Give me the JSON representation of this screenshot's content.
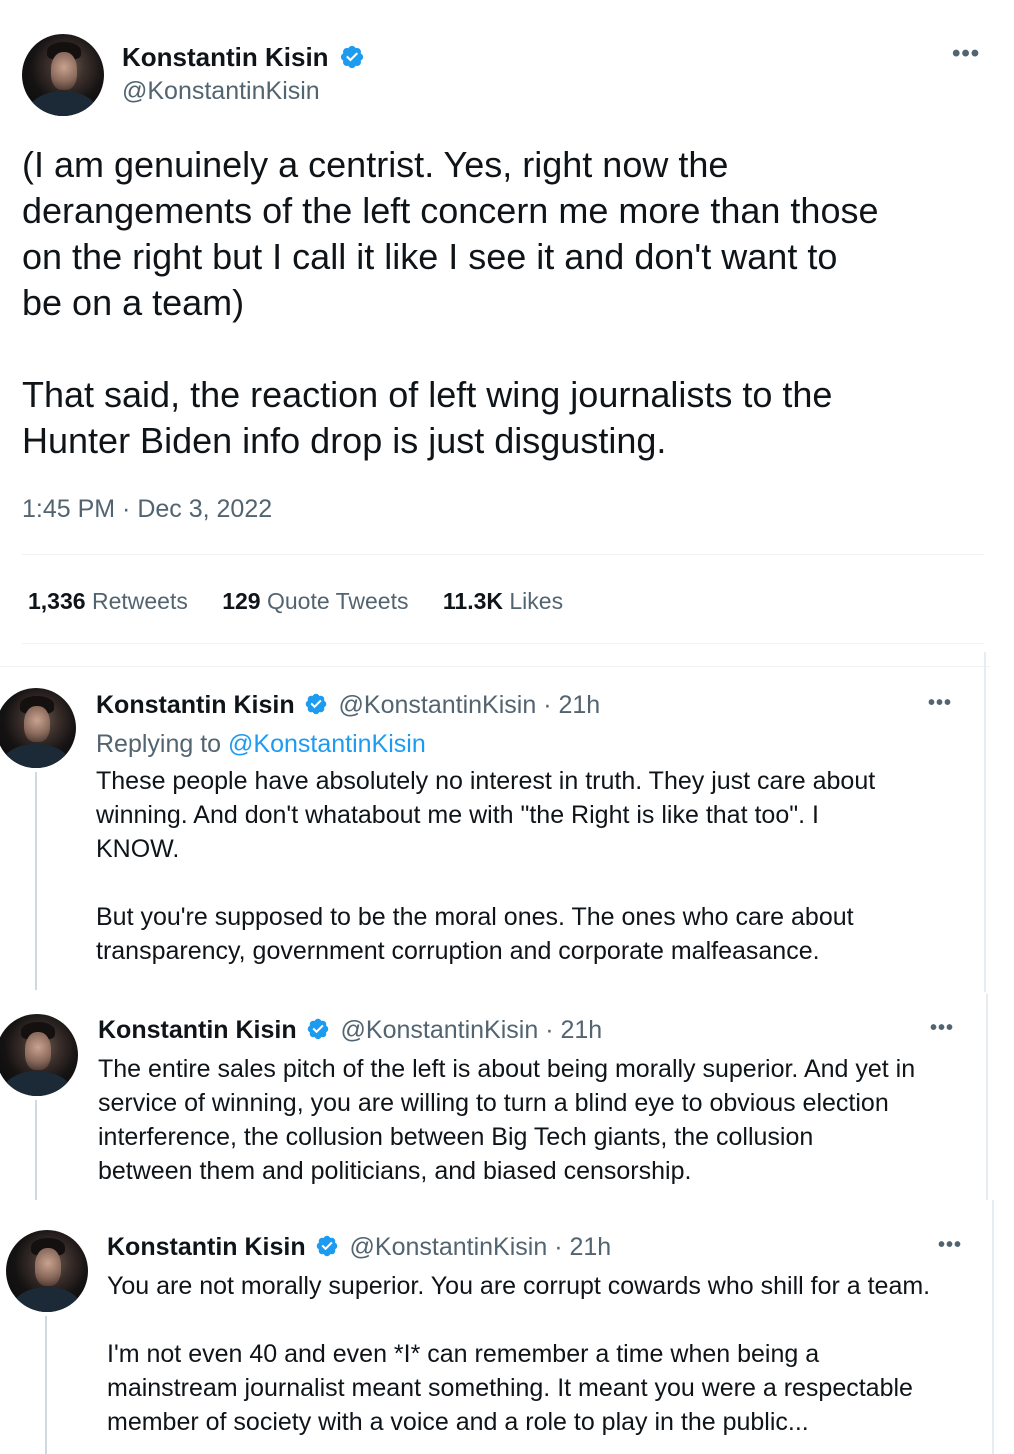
{
  "main_tweet": {
    "author_name": "Konstantin Kisin",
    "author_handle": "@KonstantinKisin",
    "more_icon": "more-horizontal-icon",
    "text": "(I am genuinely a centrist. Yes, right now the\nderangements of the left concern me more than those\non the right but I call it like I see it and don't want to\nbe on a team)\n\nThat said, the reaction of left wing journalists to the\nHunter Biden info drop is just disgusting.",
    "timestamp": "1:45 PM · Dec 3, 2022",
    "stats": [
      {
        "count": "1,336",
        "label": "Retweets"
      },
      {
        "count": "129",
        "label": "Quote Tweets"
      },
      {
        "count": "11.3K",
        "label": "Likes"
      }
    ]
  },
  "replies": [
    {
      "author_name": "Konstantin Kisin",
      "author_handle": "@KonstantinKisin",
      "age": "21h",
      "replying_to_prefix": "Replying to",
      "replying_to_handle": "@KonstantinKisin",
      "text": "These people have absolutely no interest in truth. They just care about\nwinning. And don't whatabout me with \"the Right is like that too\". I\nKNOW.\n\nBut you're supposed to be the moral ones. The ones who care about\ntransparency, government corruption and corporate malfeasance."
    },
    {
      "author_name": "Konstantin Kisin",
      "author_handle": "@KonstantinKisin",
      "age": "21h",
      "text": "The entire sales pitch of the left is about being morally superior. And yet in\nservice of winning, you are willing to turn a blind eye to obvious election\ninterference, the collusion between Big Tech giants, the collusion\nbetween them and politicians, and biased censorship."
    },
    {
      "author_name": "Konstantin Kisin",
      "author_handle": "@KonstantinKisin",
      "age": "21h",
      "text": "You are not morally superior. You are corrupt cowards who shill for a team.\n\nI'm not even 40 and even *I* can remember a time when being a\nmainstream journalist meant something. It meant you were a respectable\nmember of society with a voice and a role to play in the public..."
    }
  ],
  "colors": {
    "verified_blue": "#1d9bf0",
    "muted_text": "#536471",
    "primary_text": "#0f1419",
    "divider": "#eff3f4"
  }
}
